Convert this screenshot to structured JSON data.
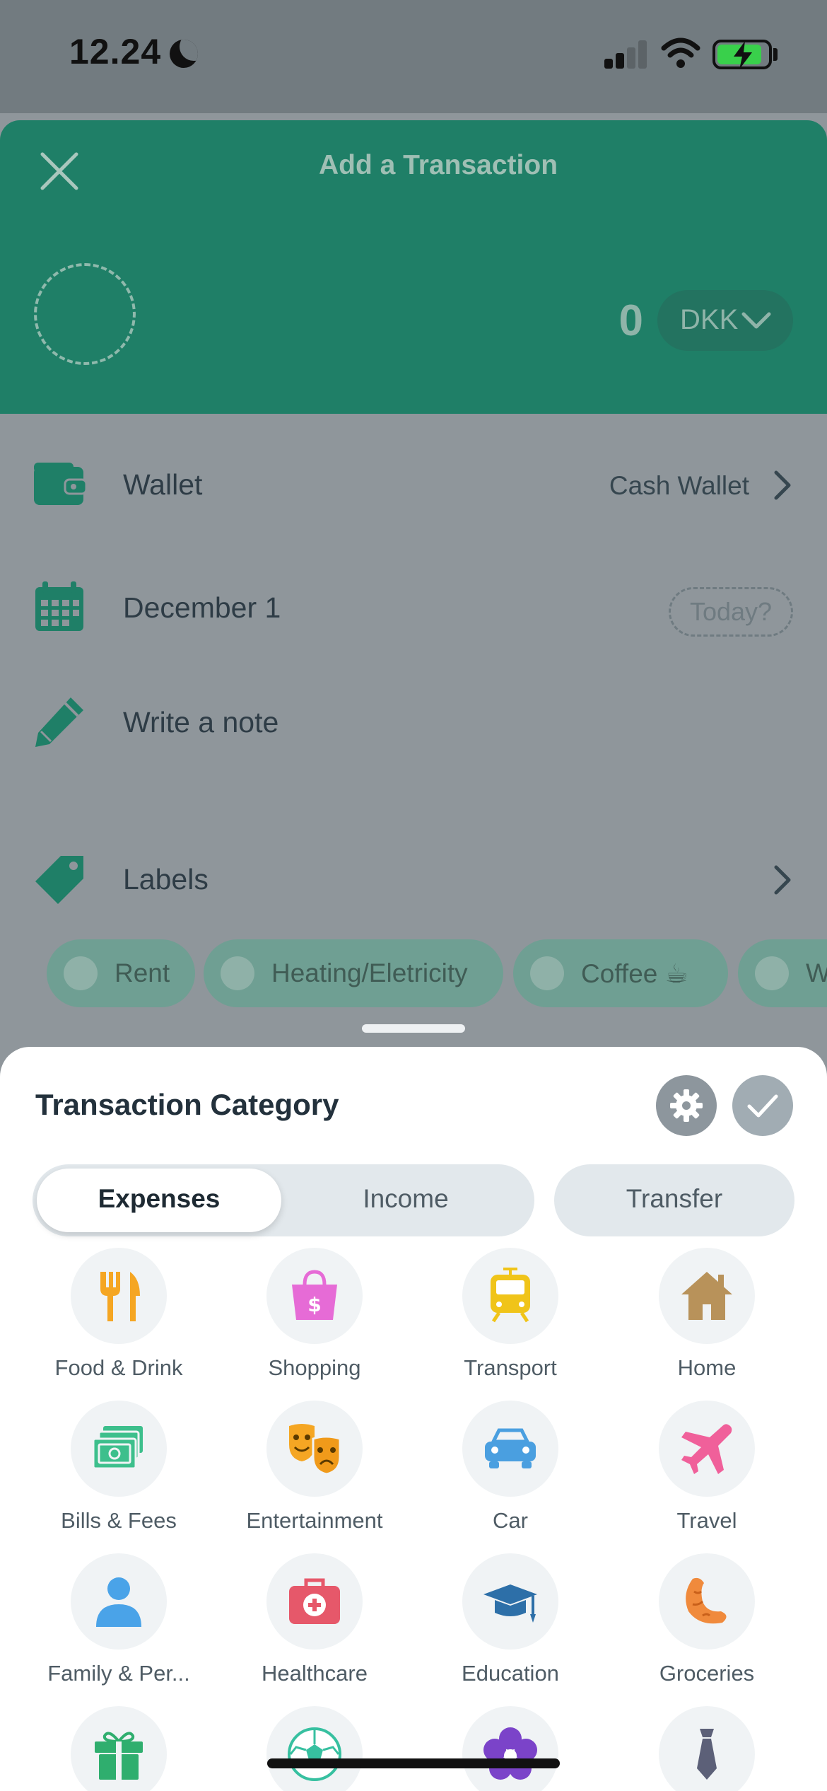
{
  "status_bar": {
    "time": "12.24"
  },
  "header": {
    "title": "Add a Transaction",
    "amount": "0",
    "currency": "DKK"
  },
  "rows": {
    "wallet": {
      "label": "Wallet",
      "value": "Cash Wallet"
    },
    "date": {
      "label": "December 1",
      "today": "Today?"
    },
    "note": {
      "placeholder": "Write a note"
    },
    "labels": {
      "label": "Labels"
    }
  },
  "label_chips": [
    "Rent",
    "Heating/Eletricity",
    "Coffee ☕",
    "W"
  ],
  "sheet": {
    "title": "Transaction Category",
    "tabs": [
      "Expenses",
      "Income",
      "Transfer"
    ],
    "categories": [
      {
        "label": "Food & Drink",
        "icon": "fork-knife-icon",
        "color": "#f5a623"
      },
      {
        "label": "Shopping",
        "icon": "shopping-bag-icon",
        "color": "#e66bd6"
      },
      {
        "label": "Transport",
        "icon": "train-icon",
        "color": "#f0c419"
      },
      {
        "label": "Home",
        "icon": "house-icon",
        "color": "#b8925a"
      },
      {
        "label": "Bills & Fees",
        "icon": "cash-icon",
        "color": "#3dbf8c"
      },
      {
        "label": "Entertainment",
        "icon": "theater-masks-icon",
        "color": "#f5a623"
      },
      {
        "label": "Car",
        "icon": "car-icon",
        "color": "#4a9fe0"
      },
      {
        "label": "Travel",
        "icon": "airplane-icon",
        "color": "#f0609a"
      },
      {
        "label": "Family & Per...",
        "icon": "person-icon",
        "color": "#4aa3e8"
      },
      {
        "label": "Healthcare",
        "icon": "medical-bag-icon",
        "color": "#e6586a"
      },
      {
        "label": "Education",
        "icon": "graduation-cap-icon",
        "color": "#2d6fa8"
      },
      {
        "label": "Groceries",
        "icon": "croissant-icon",
        "color": "#f08a3c"
      },
      {
        "label": "",
        "icon": "gift-icon",
        "color": "#2fae6e"
      },
      {
        "label": "",
        "icon": "soccer-ball-icon",
        "color": "#37c0a0"
      },
      {
        "label": "",
        "icon": "flower-icon",
        "color": "#7b43c9"
      },
      {
        "label": "",
        "icon": "tie-icon",
        "color": "#5c6078"
      }
    ]
  },
  "colors": {
    "brand_green": "#1f7f67",
    "sheet_bg": "#ffffff"
  }
}
